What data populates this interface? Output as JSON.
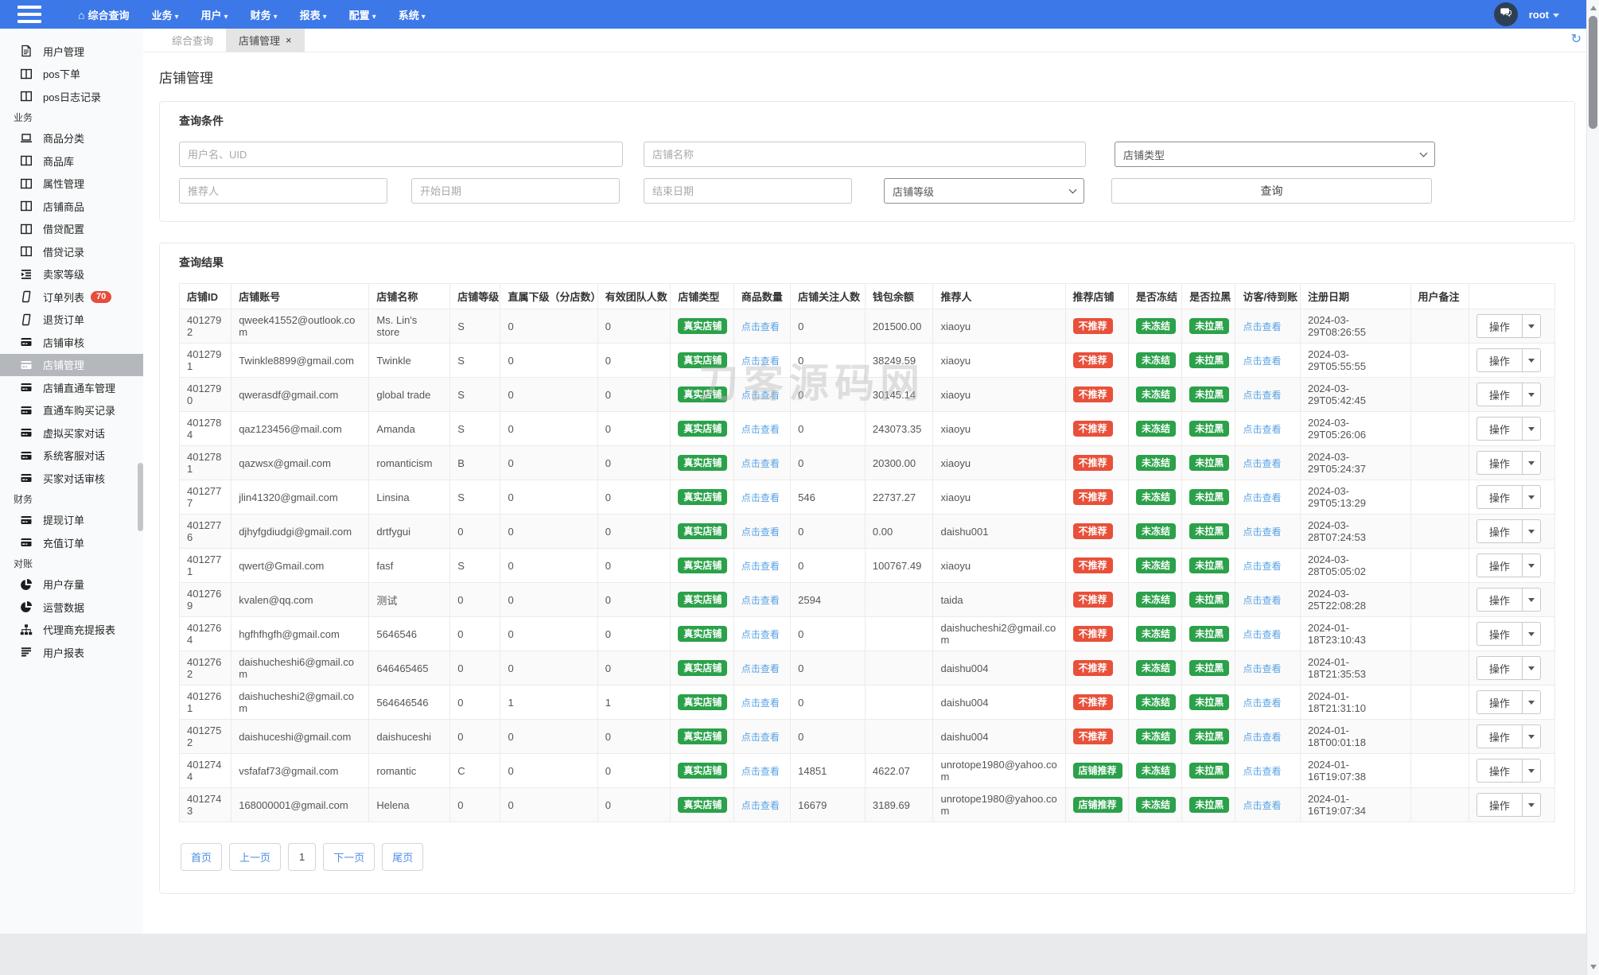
{
  "navbar": {
    "menu": [
      {
        "label": "综合查询",
        "home_icon": true,
        "caret": false
      },
      {
        "label": "业务",
        "home_icon": false,
        "caret": true
      },
      {
        "label": "用户",
        "home_icon": false,
        "caret": true
      },
      {
        "label": "财务",
        "home_icon": false,
        "caret": true
      },
      {
        "label": "报表",
        "home_icon": false,
        "caret": true
      },
      {
        "label": "配置",
        "home_icon": false,
        "caret": true
      },
      {
        "label": "系统",
        "home_icon": false,
        "caret": true
      }
    ],
    "user": "root"
  },
  "sidebar": {
    "items": [
      {
        "type": "item",
        "icon": "doc-icon",
        "label": "用户管理"
      },
      {
        "type": "item",
        "icon": "table-icon",
        "label": "pos下单"
      },
      {
        "type": "item",
        "icon": "table-icon",
        "label": "pos日志记录"
      },
      {
        "type": "section",
        "label": "业务"
      },
      {
        "type": "item",
        "icon": "laptop-icon",
        "label": "商品分类"
      },
      {
        "type": "item",
        "icon": "table-icon",
        "label": "商品库"
      },
      {
        "type": "item",
        "icon": "table-icon",
        "label": "属性管理"
      },
      {
        "type": "item",
        "icon": "table-icon",
        "label": "店铺商品"
      },
      {
        "type": "item",
        "icon": "table-icon",
        "label": "借贷配置"
      },
      {
        "type": "item",
        "icon": "table-icon",
        "label": "借贷记录"
      },
      {
        "type": "item",
        "icon": "levels-icon",
        "label": "卖家等级"
      },
      {
        "type": "item",
        "icon": "phone-icon",
        "label": "订单列表",
        "badge": "70"
      },
      {
        "type": "item",
        "icon": "phone-icon",
        "label": "退货订单"
      },
      {
        "type": "item",
        "icon": "card-icon",
        "label": "店铺审核"
      },
      {
        "type": "item",
        "icon": "card-icon",
        "label": "店铺管理",
        "active": true
      },
      {
        "type": "item",
        "icon": "card-icon",
        "label": "店铺直通车管理"
      },
      {
        "type": "item",
        "icon": "card-icon",
        "label": "直通车购买记录"
      },
      {
        "type": "item",
        "icon": "card-icon",
        "label": "虚拟买家对话"
      },
      {
        "type": "item",
        "icon": "card-icon",
        "label": "系统客服对话"
      },
      {
        "type": "item",
        "icon": "card-icon",
        "label": "买家对话审核"
      },
      {
        "type": "section",
        "label": "财务"
      },
      {
        "type": "item",
        "icon": "card-icon",
        "label": "提现订单"
      },
      {
        "type": "item",
        "icon": "card-icon",
        "label": "充值订单"
      },
      {
        "type": "section",
        "label": "对账"
      },
      {
        "type": "item",
        "icon": "pie-icon",
        "label": "用户存量"
      },
      {
        "type": "item",
        "icon": "pie-icon",
        "label": "运营数据"
      },
      {
        "type": "item",
        "icon": "sitemap-icon",
        "label": "代理商充提报表"
      },
      {
        "type": "item",
        "icon": "report-icon",
        "label": "用户报表"
      }
    ]
  },
  "tabs": [
    {
      "label": "综合查询",
      "active": false,
      "closable": false
    },
    {
      "label": "店铺管理",
      "active": true,
      "closable": true
    }
  ],
  "page": {
    "title": "店铺管理",
    "search": {
      "panel_title": "查询条件",
      "username_placeholder": "用户名、UID",
      "shopname_placeholder": "店铺名称",
      "shoptype_select": "店铺类型",
      "referrer_placeholder": "推荐人",
      "startdate_placeholder": "开始日期",
      "enddate_placeholder": "结束日期",
      "shoplevel_select": "店铺等级",
      "submit_label": "查询"
    },
    "results": {
      "panel_title": "查询结果",
      "columns": [
        "店铺ID",
        "店铺账号",
        "店铺名称",
        "店铺等级",
        "直属下级（分店数）",
        "有效团队人数",
        "店铺类型",
        "商品数量",
        "店铺关注人数",
        "钱包余额",
        "推荐人",
        "推荐店铺",
        "是否冻结",
        "是否拉黑",
        "访客/待到账",
        "注册日期",
        "用户备注",
        ""
      ],
      "view_link_label": "点击查看",
      "action_label": "操作",
      "rows": [
        {
          "id": "4012792",
          "account": "qweek41552@outlook.com",
          "name": "Ms. Lin's store",
          "level": "S",
          "direct": "0",
          "team": "0",
          "type": "真实店铺",
          "followers": "0",
          "balance": "201500.00",
          "referrer": "xiaoyu",
          "recommend": "不推荐",
          "recommend_variant": "red",
          "frozen": "未冻结",
          "black": "未拉黑",
          "date": "2024-03-29T08:26:55",
          "remark": ""
        },
        {
          "id": "4012791",
          "account": "Twinkle8899@gmail.com",
          "name": "Twinkle",
          "level": "S",
          "direct": "0",
          "team": "0",
          "type": "真实店铺",
          "followers": "0",
          "balance": "38249.59",
          "referrer": "xiaoyu",
          "recommend": "不推荐",
          "recommend_variant": "red",
          "frozen": "未冻结",
          "black": "未拉黑",
          "date": "2024-03-29T05:55:55",
          "remark": ""
        },
        {
          "id": "4012790",
          "account": "qwerasdf@gmail.com",
          "name": "global trade",
          "level": "S",
          "direct": "0",
          "team": "0",
          "type": "真实店铺",
          "followers": "0",
          "balance": "30145.14",
          "referrer": "xiaoyu",
          "recommend": "不推荐",
          "recommend_variant": "red",
          "frozen": "未冻结",
          "black": "未拉黑",
          "date": "2024-03-29T05:42:45",
          "remark": ""
        },
        {
          "id": "4012784",
          "account": "qaz123456@mail.com",
          "name": "Amanda",
          "level": "S",
          "direct": "0",
          "team": "0",
          "type": "真实店铺",
          "followers": "0",
          "balance": "243073.35",
          "referrer": "xiaoyu",
          "recommend": "不推荐",
          "recommend_variant": "red",
          "frozen": "未冻结",
          "black": "未拉黑",
          "date": "2024-03-29T05:26:06",
          "remark": ""
        },
        {
          "id": "4012781",
          "account": "qazwsx@gmail.com",
          "name": "romanticism",
          "level": "B",
          "direct": "0",
          "team": "0",
          "type": "真实店铺",
          "followers": "0",
          "balance": "20300.00",
          "referrer": "xiaoyu",
          "recommend": "不推荐",
          "recommend_variant": "red",
          "frozen": "未冻结",
          "black": "未拉黑",
          "date": "2024-03-29T05:24:37",
          "remark": ""
        },
        {
          "id": "4012777",
          "account": "jlin41320@gmail.com",
          "name": "Linsina",
          "level": "S",
          "direct": "0",
          "team": "0",
          "type": "真实店铺",
          "followers": "546",
          "balance": "22737.27",
          "referrer": "xiaoyu",
          "recommend": "不推荐",
          "recommend_variant": "red",
          "frozen": "未冻结",
          "black": "未拉黑",
          "date": "2024-03-29T05:13:29",
          "remark": ""
        },
        {
          "id": "4012776",
          "account": "djhyfgdiudgi@gmail.com",
          "name": "drtfygui",
          "level": "0",
          "direct": "0",
          "team": "0",
          "type": "真实店铺",
          "followers": "0",
          "balance": "0.00",
          "referrer": "daishu001",
          "recommend": "不推荐",
          "recommend_variant": "red",
          "frozen": "未冻结",
          "black": "未拉黑",
          "date": "2024-03-28T07:24:53",
          "remark": ""
        },
        {
          "id": "4012771",
          "account": "qwert@Gmail.com",
          "name": "fasf",
          "level": "S",
          "direct": "0",
          "team": "0",
          "type": "真实店铺",
          "followers": "0",
          "balance": "100767.49",
          "referrer": "xiaoyu",
          "recommend": "不推荐",
          "recommend_variant": "red",
          "frozen": "未冻结",
          "black": "未拉黑",
          "date": "2024-03-28T05:05:02",
          "remark": ""
        },
        {
          "id": "4012769",
          "account": "kvalen@qq.com",
          "name": "测试",
          "level": "0",
          "direct": "0",
          "team": "0",
          "type": "真实店铺",
          "followers": "2594",
          "balance": "",
          "referrer": "taida",
          "recommend": "不推荐",
          "recommend_variant": "red",
          "frozen": "未冻结",
          "black": "未拉黑",
          "date": "2024-03-25T22:08:28",
          "remark": ""
        },
        {
          "id": "4012764",
          "account": "hgfhfhgfh@gmail.com",
          "name": "5646546",
          "level": "0",
          "direct": "0",
          "team": "0",
          "type": "真实店铺",
          "followers": "0",
          "balance": "",
          "referrer": "daishucheshi2@gmail.com",
          "recommend": "不推荐",
          "recommend_variant": "red",
          "frozen": "未冻结",
          "black": "未拉黑",
          "date": "2024-01-18T23:10:43",
          "remark": ""
        },
        {
          "id": "4012762",
          "account": "daishucheshi6@gmail.com",
          "name": "646465465",
          "level": "0",
          "direct": "0",
          "team": "0",
          "type": "真实店铺",
          "followers": "0",
          "balance": "",
          "referrer": "daishu004",
          "recommend": "不推荐",
          "recommend_variant": "red",
          "frozen": "未冻结",
          "black": "未拉黑",
          "date": "2024-01-18T21:35:53",
          "remark": ""
        },
        {
          "id": "4012761",
          "account": "daishucheshi2@gmail.com",
          "name": "564646546",
          "level": "0",
          "direct": "1",
          "team": "1",
          "type": "真实店铺",
          "followers": "0",
          "balance": "",
          "referrer": "daishu004",
          "recommend": "不推荐",
          "recommend_variant": "red",
          "frozen": "未冻结",
          "black": "未拉黑",
          "date": "2024-01-18T21:31:10",
          "remark": ""
        },
        {
          "id": "4012752",
          "account": "daishuceshi@gmail.com",
          "name": "daishuceshi",
          "level": "0",
          "direct": "0",
          "team": "0",
          "type": "真实店铺",
          "followers": "0",
          "balance": "",
          "referrer": "daishu004",
          "recommend": "不推荐",
          "recommend_variant": "red",
          "frozen": "未冻结",
          "black": "未拉黑",
          "date": "2024-01-18T00:01:18",
          "remark": ""
        },
        {
          "id": "4012744",
          "account": "vsfafaf73@gmail.com",
          "name": "romantic",
          "level": "C",
          "direct": "0",
          "team": "0",
          "type": "真实店铺",
          "followers": "14851",
          "balance": "4622.07",
          "referrer": "unrotope1980@yahoo.com",
          "recommend": "店铺推荐",
          "recommend_variant": "green",
          "frozen": "未冻结",
          "black": "未拉黑",
          "date": "2024-01-16T19:07:38",
          "remark": ""
        },
        {
          "id": "4012743",
          "account": "168000001@gmail.com",
          "name": "Helena",
          "level": "0",
          "direct": "0",
          "team": "0",
          "type": "真实店铺",
          "followers": "16679",
          "balance": "3189.69",
          "referrer": "unrotope1980@yahoo.com",
          "recommend": "店铺推荐",
          "recommend_variant": "green",
          "frozen": "未冻结",
          "black": "未拉黑",
          "date": "2024-01-16T19:07:34",
          "remark": ""
        }
      ]
    },
    "pagination": [
      "首页",
      "上一页",
      "1",
      "下一页",
      "尾页"
    ],
    "pagination_current": "1"
  },
  "watermark": "刀客源码网",
  "colors": {
    "navbar_blue": "#3c78e8",
    "badge_green": "#2ba14a",
    "badge_red": "#e8503a",
    "link_blue": "#59a3e4",
    "count_badge_red": "#e74c3c",
    "active_sidebar_gray": "#b4b8bc"
  }
}
